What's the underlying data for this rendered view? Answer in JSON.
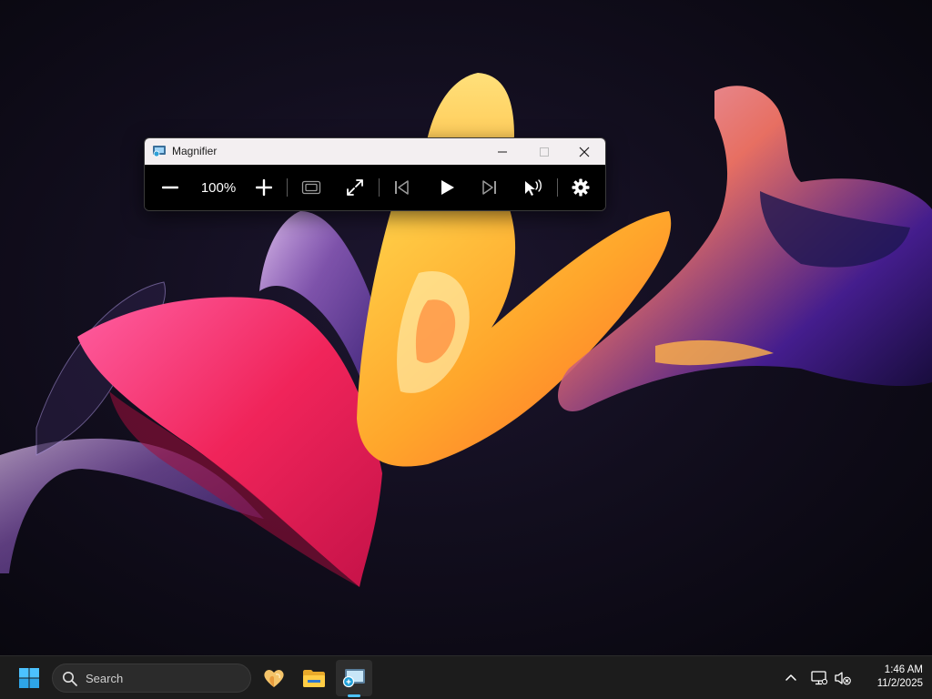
{
  "magnifier": {
    "title": "Magnifier",
    "zoom_level": "100%"
  },
  "taskbar": {
    "search_label": "Search",
    "clock_time": "1:46 AM",
    "clock_date": "11/2/2025"
  },
  "colors": {
    "accent": "#4cc2ff",
    "titlebar_bg": "#f3eff1",
    "toolbar_bg": "#000000",
    "taskbar_bg": "#1c1c1c"
  },
  "icons": {
    "toolbar": [
      "minus-icon",
      "plus-icon",
      "view-icon",
      "expand-icon",
      "previous-icon",
      "play-icon",
      "next-icon",
      "read-from-here-icon",
      "settings-icon"
    ],
    "taskbar": [
      "windows-start-icon",
      "search-icon",
      "widgets-icon",
      "file-explorer-icon",
      "magnifier-app-icon"
    ],
    "tray": [
      "chevron-up-icon",
      "network-icon",
      "volume-muted-icon"
    ]
  }
}
